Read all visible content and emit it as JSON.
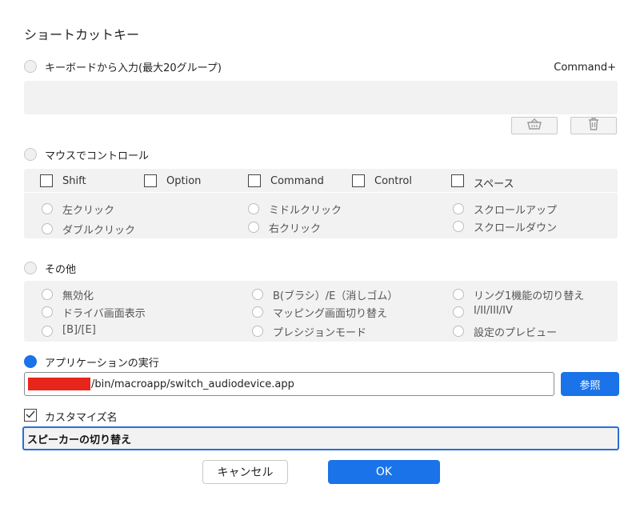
{
  "dialog": {
    "title": "ショートカットキー"
  },
  "keyboard": {
    "label": "キーボードから入力(最大20グループ)",
    "modifier_hint": "Command+",
    "value": ""
  },
  "mouse": {
    "label": "マウスでコントロール",
    "modifiers": [
      "Shift",
      "Option",
      "Command",
      "Control",
      "スペース"
    ],
    "clicks": [
      "左クリック",
      "ダブルクリック",
      "ミドルクリック",
      "右クリック",
      "スクロールアップ",
      "スクロールダウン"
    ]
  },
  "other": {
    "label": "その他",
    "options": [
      "無効化",
      "ドライバ画面表示",
      "[B]/[E]",
      "B(ブラシ）/E（消しゴム）",
      "マッピング画面切り替え",
      "プレシジョンモード",
      "リング1機能の切り替え",
      "I/II/III/IV",
      "設定のプレビュー"
    ]
  },
  "app_exec": {
    "label": "アプリケーションの実行",
    "path_suffix": "/bin/macroapp/switch_audiodevice.app",
    "browse_label": "参照"
  },
  "custom_name": {
    "label": "カスタマイズ名",
    "value": "スピーカーの切り替え"
  },
  "buttons": {
    "cancel": "キャンセル",
    "ok": "OK"
  }
}
